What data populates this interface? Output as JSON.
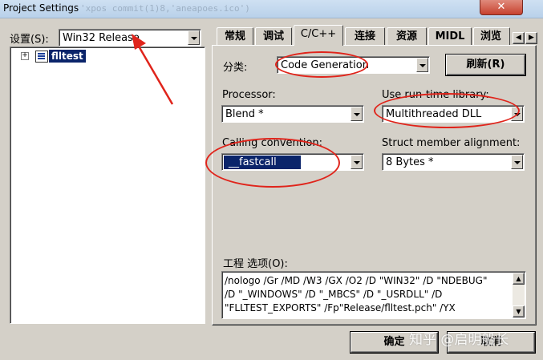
{
  "window": {
    "title": "Project Settings",
    "ghost_text": "'xpos commit(1)8,'aneapoes.ico')",
    "close_label": "✕"
  },
  "left": {
    "settings_label": "设置(S):",
    "config_value": "Win32 Release",
    "tree_root_expander": "+",
    "tree_root_label": "flltest"
  },
  "tabs": [
    {
      "label": "常规"
    },
    {
      "label": "调试"
    },
    {
      "label": "C/C++"
    },
    {
      "label": "连接"
    },
    {
      "label": "资源"
    },
    {
      "label": "MIDL"
    },
    {
      "label": "浏览"
    }
  ],
  "tab_scroll": {
    "left": "◀",
    "right": "▶"
  },
  "category": {
    "label": "分类:",
    "value": "Code Generation",
    "refresh_label": "刷新(R)"
  },
  "processor": {
    "label": "Processor:",
    "value": "Blend *"
  },
  "runtime": {
    "label": "Use run-time library:",
    "value": "Multithreaded DLL"
  },
  "calling": {
    "label": "Calling convention:",
    "value": "__fastcall"
  },
  "struct_align": {
    "label": "Struct member alignment:",
    "value": "8 Bytes *"
  },
  "project_options": {
    "label": "工程 选项(O):",
    "text": "/nologo /Gr /MD /W3 /GX /O2 /D \"WIN32\" /D \"NDEBUG\"\n/D \"_WINDOWS\" /D \"_MBCS\" /D \"_USRDLL\" /D\n\"FLLTEST_EXPORTS\" /Fp\"Release/flltest.pch\" /YX",
    "scroll_up": "▲",
    "scroll_down": "▼"
  },
  "buttons": {
    "ok": "确定",
    "cancel": "取消"
  },
  "watermark": "知乎 @启明船长",
  "colors": {
    "annotation": "#e0241b",
    "selection": "#0a246a"
  }
}
